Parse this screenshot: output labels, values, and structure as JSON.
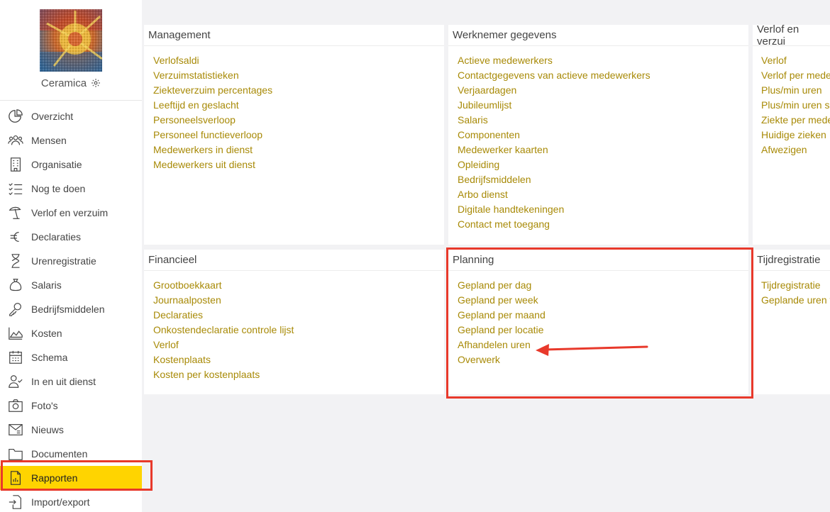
{
  "sidebar": {
    "company_name": "Ceramica",
    "items": [
      {
        "label": "Overzicht",
        "icon": "pie-chart-icon"
      },
      {
        "label": "Mensen",
        "icon": "people-icon"
      },
      {
        "label": "Organisatie",
        "icon": "building-icon"
      },
      {
        "label": "Nog te doen",
        "icon": "checklist-icon"
      },
      {
        "label": "Verlof en verzuim",
        "icon": "beach-umbrella-icon"
      },
      {
        "label": "Declaraties",
        "icon": "euro-icon"
      },
      {
        "label": "Urenregistratie",
        "icon": "hourglass-icon"
      },
      {
        "label": "Salaris",
        "icon": "money-bag-icon"
      },
      {
        "label": "Bedrijfsmiddelen",
        "icon": "key-icon"
      },
      {
        "label": "Kosten",
        "icon": "area-chart-icon"
      },
      {
        "label": "Schema",
        "icon": "calendar-icon"
      },
      {
        "label": "In en uit dienst",
        "icon": "user-check-icon"
      },
      {
        "label": "Foto's",
        "icon": "camera-icon"
      },
      {
        "label": "Nieuws",
        "icon": "newspaper-icon"
      },
      {
        "label": "Documenten",
        "icon": "folder-icon"
      },
      {
        "label": "Rapporten",
        "icon": "report-icon",
        "active": true
      },
      {
        "label": "Import/export",
        "icon": "import-export-icon"
      }
    ]
  },
  "panels": {
    "management": {
      "title": "Management",
      "links": [
        "Verlofsaldi",
        "Verzuimstatistieken",
        "Ziekteverzuim percentages",
        "Leeftijd en geslacht",
        "Personeelsverloop",
        "Personeel functieverloop",
        "Medewerkers in dienst",
        "Medewerkers uit dienst"
      ]
    },
    "werknemer": {
      "title": "Werknemer gegevens",
      "links": [
        "Actieve medewerkers",
        "Contactgegevens van actieve medewerkers",
        "Verjaardagen",
        "Jubileumlijst",
        "Salaris",
        "Componenten",
        "Medewerker kaarten",
        "Opleiding",
        "Bedrijfsmiddelen",
        "Arbo dienst",
        "Digitale handtekeningen",
        "Contact met toegang"
      ]
    },
    "verlof": {
      "title": "Verlof en verzui",
      "links": [
        "Verlof",
        "Verlof per mede",
        "Plus/min uren",
        "Plus/min uren s",
        "Ziekte per mede",
        "Huidige zieken",
        "Afwezigen"
      ]
    },
    "financieel": {
      "title": "Financieel",
      "links": [
        "Grootboekkaart",
        "Journaalposten",
        "Declaraties",
        "Onkostendeclaratie controle lijst",
        "Verlof",
        "Kostenplaats",
        "Kosten per kostenplaats"
      ]
    },
    "planning": {
      "title": "Planning",
      "links": [
        "Gepland per dag",
        "Gepland per week",
        "Gepland per maand",
        "Gepland per locatie",
        "Afhandelen uren",
        "Overwerk"
      ]
    },
    "tijdregistratie": {
      "title": "Tijdregistratie",
      "links": [
        "Tijdregistratie",
        "Geplande uren v"
      ]
    }
  },
  "colors": {
    "link": "#a88a07",
    "active_nav": "#ffd400",
    "highlight": "#e8392b"
  }
}
